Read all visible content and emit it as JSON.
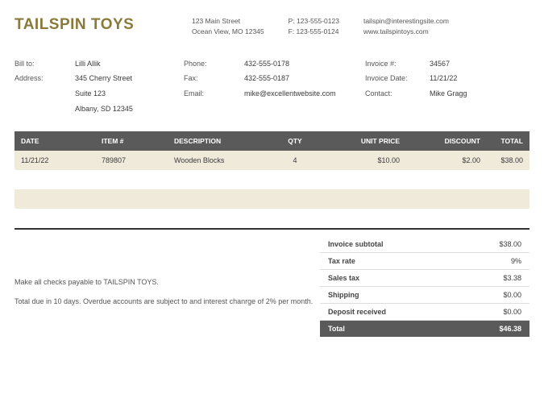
{
  "company": {
    "name": "TAILSPIN TOYS",
    "address1": "123 Main Street",
    "address2": "Ocean View, MO 12345",
    "phone": "P: 123-555-0123",
    "fax": "F: 123-555-0124",
    "email": "tailspin@interestingsite.com",
    "website": "www.tailspintoys.com"
  },
  "billto": {
    "label_billto": "Bill to:",
    "label_address": "Address:",
    "name": "Lilli Allik",
    "street": "345 Cherry Street",
    "suite": "Suite 123",
    "city": "Albany, SD 12345",
    "label_phone": "Phone:",
    "label_fax": "Fax:",
    "label_email": "Email:",
    "phone": "432-555-0178",
    "fax": "432-555-0187",
    "email": "mike@excellentwebsite.com"
  },
  "invoice": {
    "label_num": "Invoice #:",
    "label_date": "Invoice Date:",
    "label_contact": "Contact:",
    "number": "34567",
    "date": "11/21/22",
    "contact": "Mike Gragg"
  },
  "columns": {
    "date": "DATE",
    "item": "ITEM #",
    "desc": "DESCRIPTION",
    "qty": "QTY",
    "price": "UNIT PRICE",
    "discount": "DISCOUNT",
    "total": "TOTAL"
  },
  "rows": [
    {
      "date": "11/21/22",
      "item": "789807",
      "desc": "Wooden Blocks",
      "qty": "4",
      "price": "$10.00",
      "discount": "$2.00",
      "total": "$38.00"
    }
  ],
  "notes": {
    "payable": "Make all checks payable to TAILSPIN TOYS.",
    "terms": "Total due in 10 days. Overdue accounts are subject to and interest chanrge of 2% per month."
  },
  "summary": {
    "subtotal_label": "Invoice subtotal",
    "subtotal": "$38.00",
    "taxrate_label": "Tax rate",
    "taxrate": "9%",
    "salestax_label": "Sales tax",
    "salestax": "$3.38",
    "shipping_label": "Shipping",
    "shipping": "$0.00",
    "deposit_label": "Deposit received",
    "deposit": "$0.00",
    "total_label": "Total",
    "total": "$46.38"
  }
}
